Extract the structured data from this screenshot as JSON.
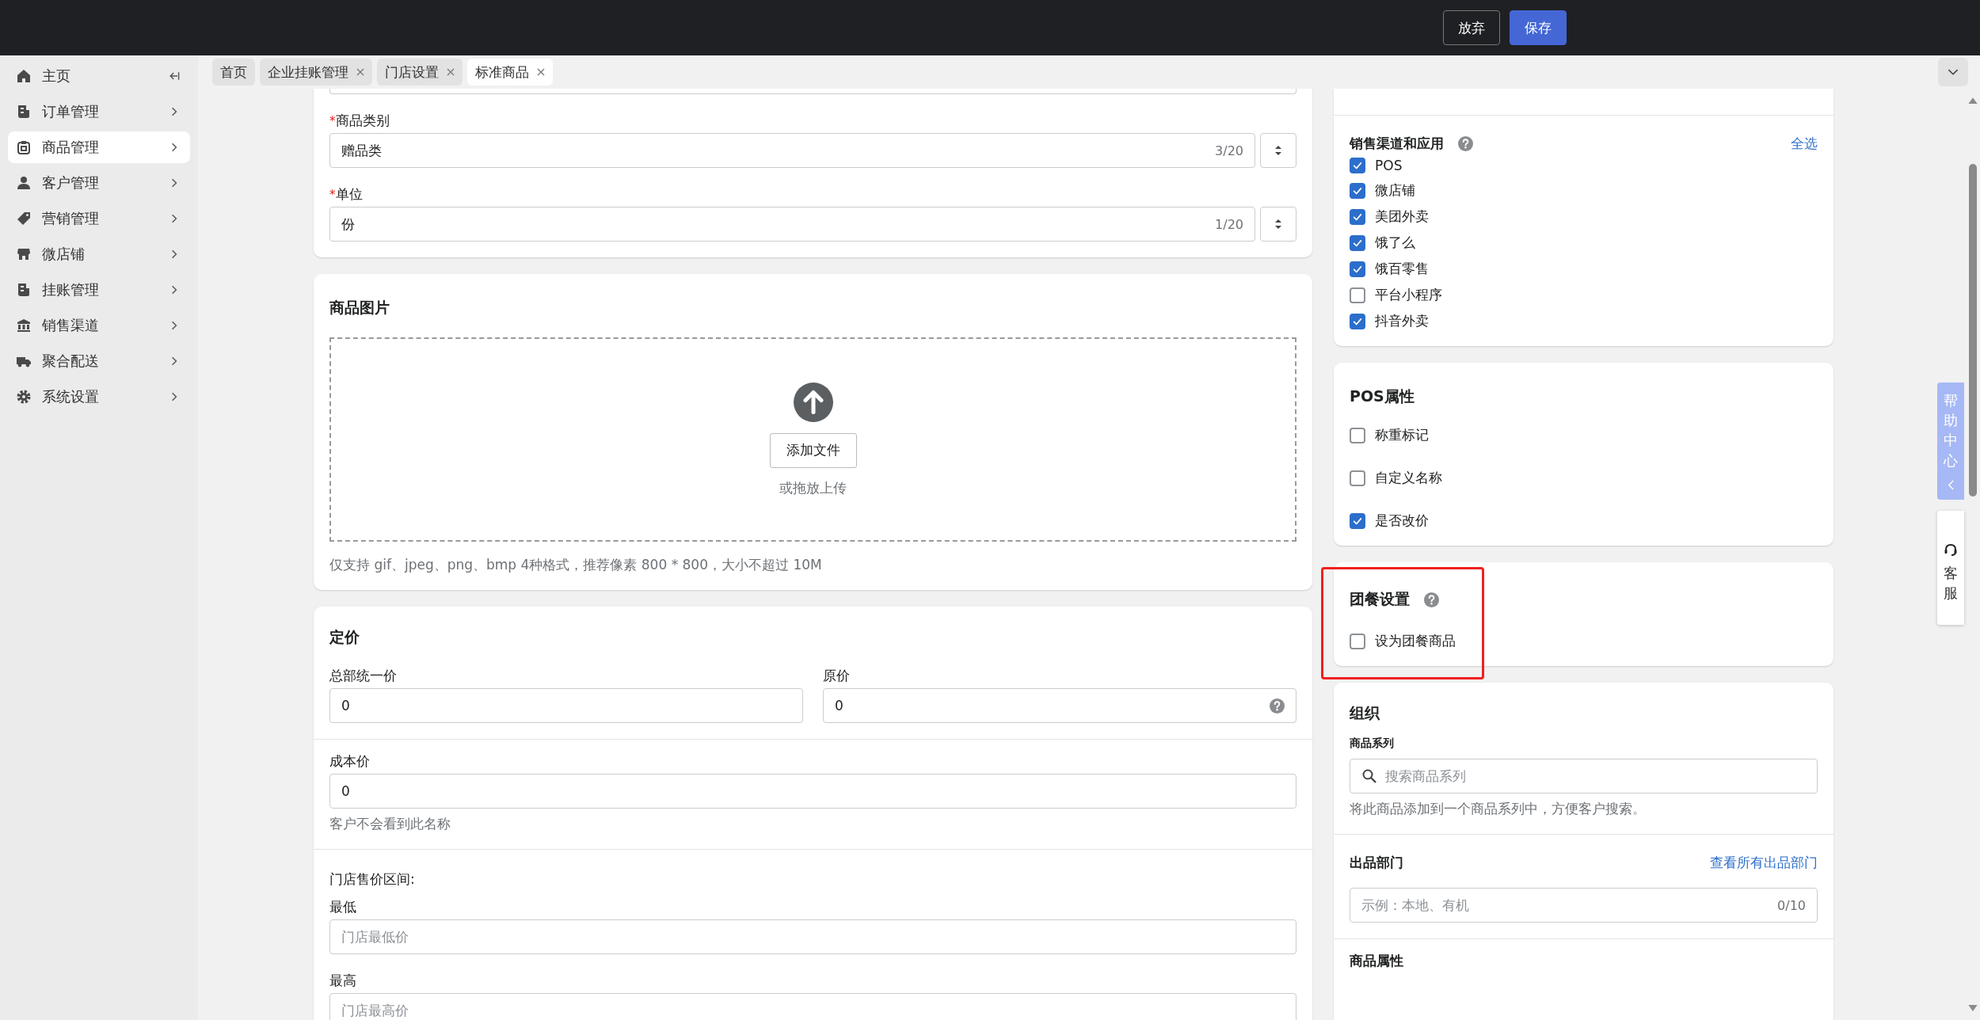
{
  "top_bar": {
    "buttons": [
      {
        "label": "放弃",
        "kind": "secondary"
      },
      {
        "label": "保存",
        "kind": "primary"
      }
    ]
  },
  "sidebar": {
    "items": [
      {
        "label": "主页",
        "selected": false
      },
      {
        "label": "订单管理",
        "selected": false
      },
      {
        "label": "商品管理",
        "selected": true
      },
      {
        "label": "客户管理",
        "selected": false
      },
      {
        "label": "营销管理",
        "selected": false
      },
      {
        "label": "微店铺",
        "selected": false
      },
      {
        "label": "挂账管理",
        "selected": false
      },
      {
        "label": "销售渠道",
        "selected": false
      },
      {
        "label": "聚合配送",
        "selected": false
      },
      {
        "label": "系统设置",
        "selected": false
      }
    ]
  },
  "tabs": [
    {
      "label": "首页",
      "closable": false,
      "selected": false
    },
    {
      "label": "企业挂账管理",
      "closable": true,
      "selected": false
    },
    {
      "label": "门店设置",
      "closable": true,
      "selected": false
    },
    {
      "label": "标准商品",
      "closable": true,
      "selected": true
    }
  ],
  "product_type": {
    "required_mark": "*",
    "fields": [
      {
        "label": "商品类别",
        "required": true,
        "value": "赠品类",
        "counter": "3/20"
      },
      {
        "label": "单位",
        "required": true,
        "value": "份",
        "counter": "1/20"
      }
    ]
  },
  "product_images": {
    "title": "商品图片",
    "button": "添加文件",
    "drop_hint": "或拖放上传",
    "note": "仅支持 gif、jpeg、png、bmp 4种格式，推荐像素 800 * 800，大小不超过 10M"
  },
  "pricing": {
    "title": "定价",
    "unified_price": {
      "label": "总部统一价",
      "value": "0"
    },
    "original_price": {
      "label": "原价",
      "value": "0"
    },
    "cost_price": {
      "label": "成本价",
      "value": "0",
      "hint": "客户不会看到此名称"
    },
    "store_range": {
      "label": "门店售价区间:",
      "min": {
        "label": "最低",
        "placeholder": "门店最低价"
      },
      "max": {
        "label": "最高",
        "placeholder": "门店最高价"
      }
    }
  },
  "sales_channels": {
    "title": "销售渠道和应用",
    "select_all": "全选",
    "items": [
      {
        "label": "POS",
        "checked": true
      },
      {
        "label": "微店铺",
        "checked": true
      },
      {
        "label": "美团外卖",
        "checked": true
      },
      {
        "label": "饿了么",
        "checked": true
      },
      {
        "label": "饿百零售",
        "checked": true
      },
      {
        "label": "平台小程序",
        "checked": false
      },
      {
        "label": "抖音外卖",
        "checked": true
      }
    ]
  },
  "pos_attributes": {
    "title": "POS属性",
    "items": [
      {
        "label": "称重标记",
        "checked": false
      },
      {
        "label": "自定义名称",
        "checked": false
      },
      {
        "label": "是否改价",
        "checked": true
      }
    ]
  },
  "group_meal": {
    "title": "团餐设置",
    "highlighted": true,
    "items": [
      {
        "label": "设为团餐商品",
        "checked": false
      }
    ]
  },
  "organization": {
    "title": "组织",
    "series": {
      "label": "商品系列",
      "placeholder": "搜索商品系列",
      "hint": "将此商品添加到一个商品系列中，方便客户搜索。"
    },
    "department": {
      "label": "出品部门",
      "link": "查看所有出品部门",
      "placeholder": "示例：本地、有机",
      "counter": "0/10"
    },
    "attributes_title": "商品属性"
  },
  "help_center": {
    "label": "帮助中心"
  },
  "customer_service": {
    "label": "客服"
  }
}
